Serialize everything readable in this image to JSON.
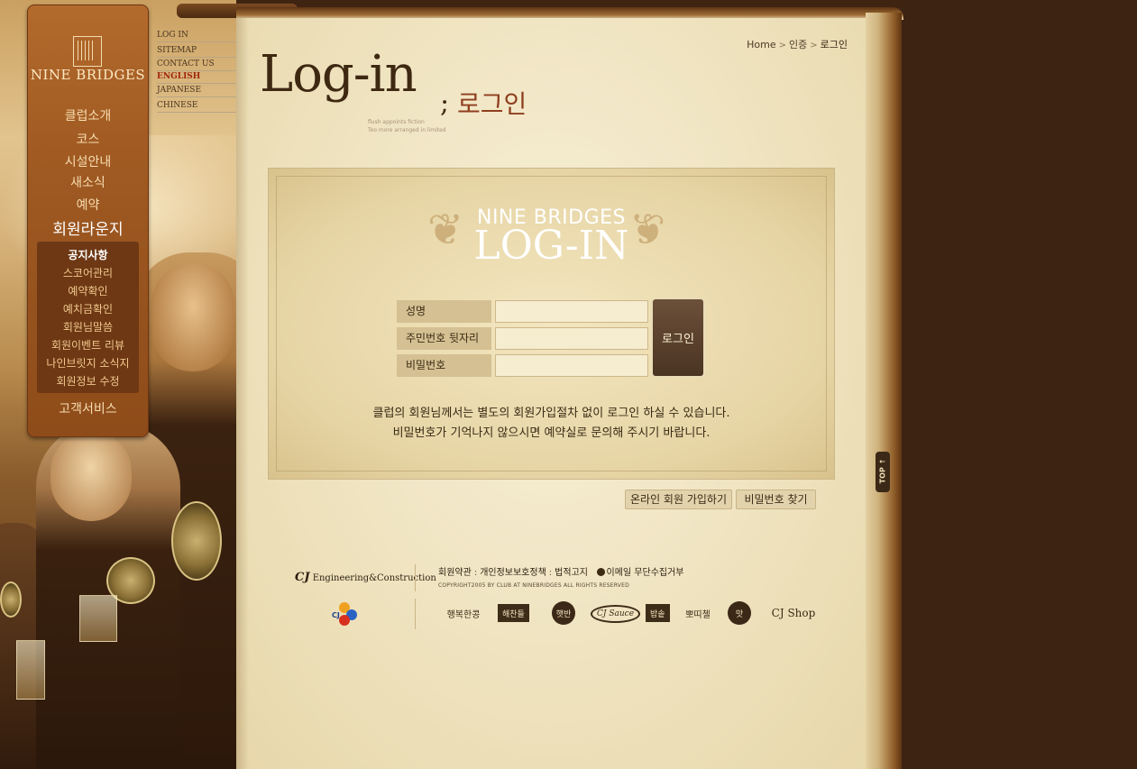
{
  "top_links": [
    {
      "label": "LOG IN",
      "active": false
    },
    {
      "label": "SITEMAP",
      "active": false
    },
    {
      "label": "CONTACT US",
      "active": false
    },
    {
      "label": "ENGLISH",
      "active": true
    },
    {
      "label": "JAPANESE",
      "active": false
    },
    {
      "label": "CHINESE",
      "active": false
    }
  ],
  "brand": {
    "logo_text": "NINE BRIDGES"
  },
  "nav": {
    "main": [
      "클럽소개",
      "코스",
      "시설안내",
      "새소식",
      "예약",
      "회원라운지"
    ],
    "active_main": "회원라운지",
    "sub": [
      "공지사항",
      "스코어관리",
      "예약확인",
      "예치금확인",
      "회원님말씀",
      "회원이벤트 리뷰",
      "나인브릿지 소식지",
      "회원정보 수정"
    ],
    "active_sub": "공지사항",
    "last": "고객서비스"
  },
  "breadcrumb": {
    "home": "Home",
    "level1": "인증",
    "current": "로그인",
    "separator": ">"
  },
  "page_title": {
    "en": "Log-in",
    "semicolon": ";",
    "ko": "로그인",
    "note_line1": "flush appoints fiction",
    "note_line2": "Too more arranged in limited"
  },
  "login_panel": {
    "title_line1": "NINE BRIDGES",
    "title_line2": "LOG-IN",
    "fields": [
      {
        "label": "성명",
        "value": ""
      },
      {
        "label": "주민번호 뒷자리",
        "value": ""
      },
      {
        "label": "비밀번호",
        "value": ""
      }
    ],
    "submit_label": "로그인",
    "notice_line1": "클럽의 회원님께서는 별도의 회원가입절차 없이 로그인 하실 수 있습니다.",
    "notice_line2": "비밀번호가 기억나지 않으시면 예약실로 문의해 주시기 바랍니다."
  },
  "actions": {
    "join_label": "온라인 회원 가입하기",
    "find_pw_label": "비밀번호 찾기"
  },
  "footer": {
    "company_mark": "CJ",
    "company_name": "Engineering&Construction",
    "cj_logo_text": "CJ",
    "links": [
      "회원약관",
      "개인정보보호정책",
      "법적고지"
    ],
    "link_separator": ":",
    "email_notice": "이메일 무단수집거부",
    "copyright": "COPYRIGHT2005 BY CLUB AT NINEBRIDGES ALL RIGHTS RESERVED",
    "brands": [
      "행복한콩",
      "해찬들",
      "햇반",
      "CJ Sauce",
      "밥솥",
      "뽀띠첼",
      "맛",
      "CJ Shop"
    ]
  },
  "top_button": {
    "label": "TOP ↑"
  },
  "colors": {
    "page_bg": "#3f2412",
    "nav_panel": "#a05a22",
    "paper": "#f1e5c4",
    "accent_red": "#a0260e"
  }
}
